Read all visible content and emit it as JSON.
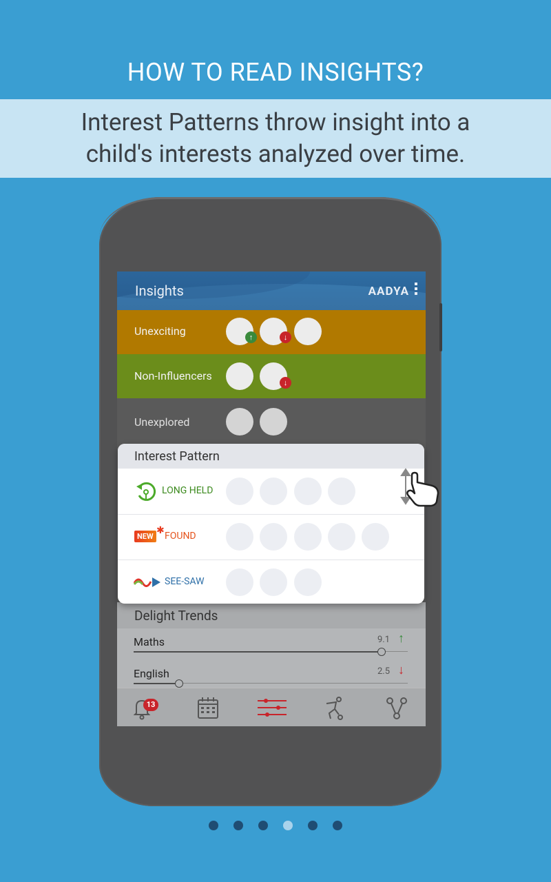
{
  "page": {
    "title": "HOW TO READ INSIGHTS?",
    "subtitle_line1": "Interest Patterns throw insight into a",
    "subtitle_line2": "child's interests analyzed over time."
  },
  "app": {
    "title": "Insights",
    "brand": "AADYA"
  },
  "categories": [
    {
      "label": "Unexciting",
      "color": "#b17900"
    },
    {
      "label": "Non-Influencers",
      "color": "#6b8d1b"
    },
    {
      "label": "Unexplored",
      "color": "#5a5a5a"
    }
  ],
  "interest_pattern": {
    "title": "Interest Pattern",
    "rows": [
      {
        "label": "LONG HELD",
        "color": "#3c8a1e"
      },
      {
        "label": "FOUND",
        "badge": "NEW",
        "color": "#e5531c"
      },
      {
        "label": "SEE-SAW",
        "color": "#2f70a8"
      }
    ]
  },
  "delight_trends": {
    "title": "Delight Trends",
    "subjects": [
      {
        "name": "Maths",
        "value": "9.1",
        "trend": "up"
      },
      {
        "name": "English",
        "value": "2.5",
        "trend": "down"
      }
    ]
  },
  "tabs": {
    "notification_count": "13",
    "items": [
      "bell-icon",
      "calendar-icon",
      "sliders-icon",
      "sports-icon",
      "share-icon"
    ]
  },
  "colors": {
    "background": "#3a9ed2",
    "accent_red": "#c8242a",
    "accent_green": "#3a8a3c"
  },
  "pagination": {
    "total": 6,
    "active": 4
  }
}
